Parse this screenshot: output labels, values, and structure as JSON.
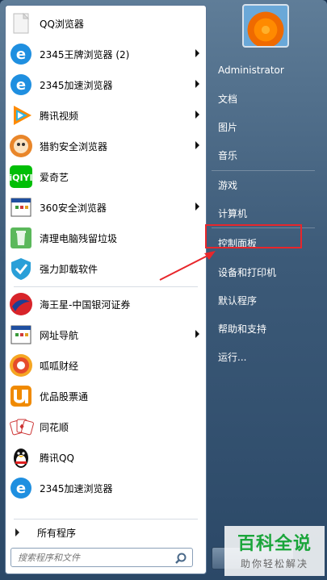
{
  "left_items": [
    {
      "label": "QQ浏览器",
      "icon": "qq-browser-icon",
      "arrow": false
    },
    {
      "label": "2345王牌浏览器 (2)",
      "icon": "ie-e-icon",
      "arrow": true
    },
    {
      "label": "2345加速浏览器",
      "icon": "ie-e-icon",
      "arrow": true
    },
    {
      "label": "腾讯视频",
      "icon": "tencent-video-icon",
      "arrow": true
    },
    {
      "label": "猎豹安全浏览器",
      "icon": "cheetah-browser-icon",
      "arrow": true
    },
    {
      "label": "爱奇艺",
      "icon": "iqiyi-icon",
      "arrow": false
    },
    {
      "label": "360安全浏览器",
      "icon": "app-window-icon",
      "arrow": true
    },
    {
      "label": "清理电脑残留垃圾",
      "icon": "recycle-bin-icon",
      "arrow": false
    },
    {
      "label": "强力卸载软件",
      "icon": "uninstall-shield-icon",
      "arrow": false
    },
    {
      "label": "海王星-中国银河证券",
      "icon": "galaxy-securities-icon",
      "arrow": false
    },
    {
      "label": "网址导航",
      "icon": "app-window-icon",
      "arrow": true
    },
    {
      "label": "呱呱财经",
      "icon": "guagua-icon",
      "arrow": false
    },
    {
      "label": "优品股票通",
      "icon": "youpin-icon",
      "arrow": false
    },
    {
      "label": "同花顺",
      "icon": "tonghuashun-icon",
      "arrow": false
    },
    {
      "label": "腾讯QQ",
      "icon": "qq-penguin-icon",
      "arrow": false
    },
    {
      "label": "2345加速浏览器",
      "icon": "ie-e-icon",
      "arrow": false
    }
  ],
  "all_programs": "所有程序",
  "search": {
    "placeholder": "搜索程序和文件"
  },
  "right_items": [
    {
      "label": "Administrator"
    },
    {
      "label": "文档"
    },
    {
      "label": "图片"
    },
    {
      "label": "音乐"
    },
    {
      "label": "游戏"
    },
    {
      "label": "计算机"
    },
    {
      "label": "控制面板"
    },
    {
      "label": "设备和打印机"
    },
    {
      "label": "默认程序"
    },
    {
      "label": "帮助和支持"
    },
    {
      "label": "运行..."
    }
  ],
  "watermark": {
    "title": "百科全说",
    "subtitle": "助你轻松解决"
  },
  "colors": {
    "highlight": "#e8262b",
    "menu_bg": "#3c5a78",
    "watermark_green": "#1aa53a"
  }
}
